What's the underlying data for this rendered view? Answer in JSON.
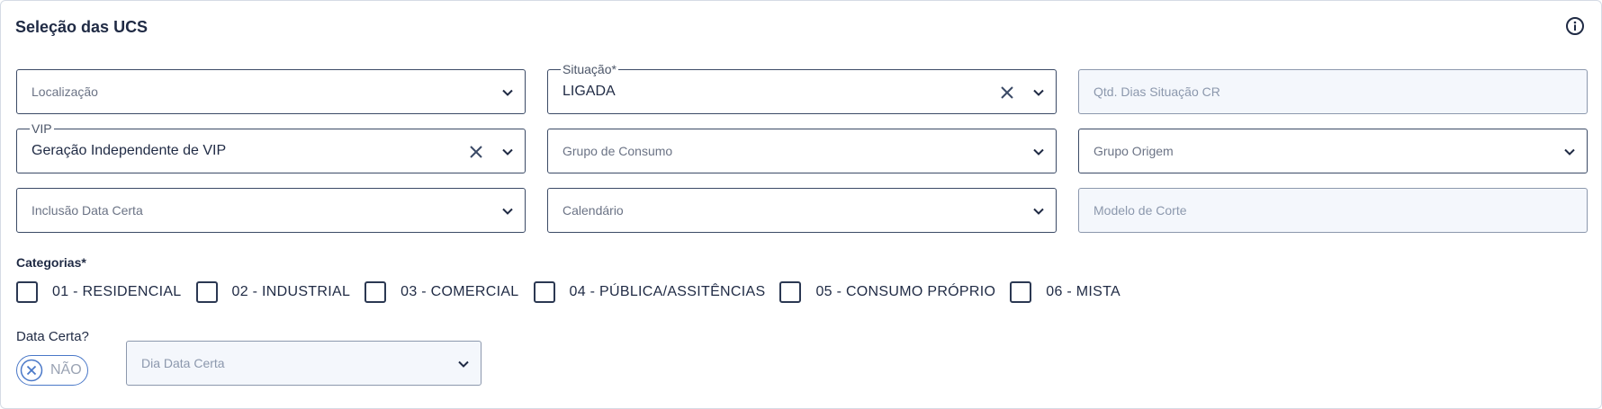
{
  "section": {
    "title": "Seleção das UCS",
    "info_icon": "info-circle-icon"
  },
  "fields": {
    "localizacao": {
      "placeholder": "Localização"
    },
    "situacao": {
      "label": "Situação*",
      "value": "LIGADA"
    },
    "qtd_dias": {
      "placeholder": "Qtd. Dias Situação CR"
    },
    "vip": {
      "label": "VIP",
      "value": "Geração Independente de VIP"
    },
    "grupo_consumo": {
      "placeholder": "Grupo de Consumo"
    },
    "grupo_origem": {
      "placeholder": "Grupo Origem"
    },
    "inclusao_data_certa": {
      "placeholder": "Inclusão Data Certa"
    },
    "calendario": {
      "placeholder": "Calendário"
    },
    "modelo_corte": {
      "placeholder": "Modelo de Corte"
    },
    "dia_data_certa": {
      "placeholder": "Dia Data Certa"
    }
  },
  "categorias": {
    "label": "Categorias*",
    "items": [
      {
        "label": "01 - RESIDENCIAL",
        "checked": false
      },
      {
        "label": "02 - INDUSTRIAL",
        "checked": false
      },
      {
        "label": "03 - COMERCIAL",
        "checked": false
      },
      {
        "label": "04 - PÚBLICA/ASSITÊNCIAS",
        "checked": false
      },
      {
        "label": "05 - CONSUMO PRÓPRIO",
        "checked": false
      },
      {
        "label": "06 - MISTA",
        "checked": false
      }
    ]
  },
  "data_certa": {
    "label": "Data Certa?",
    "toggle_label": "NÃO",
    "enabled": false
  },
  "colors": {
    "border": "#3b4a66",
    "disabled_bg": "#f4f7fc",
    "toggle_accent": "#4a78c8"
  }
}
